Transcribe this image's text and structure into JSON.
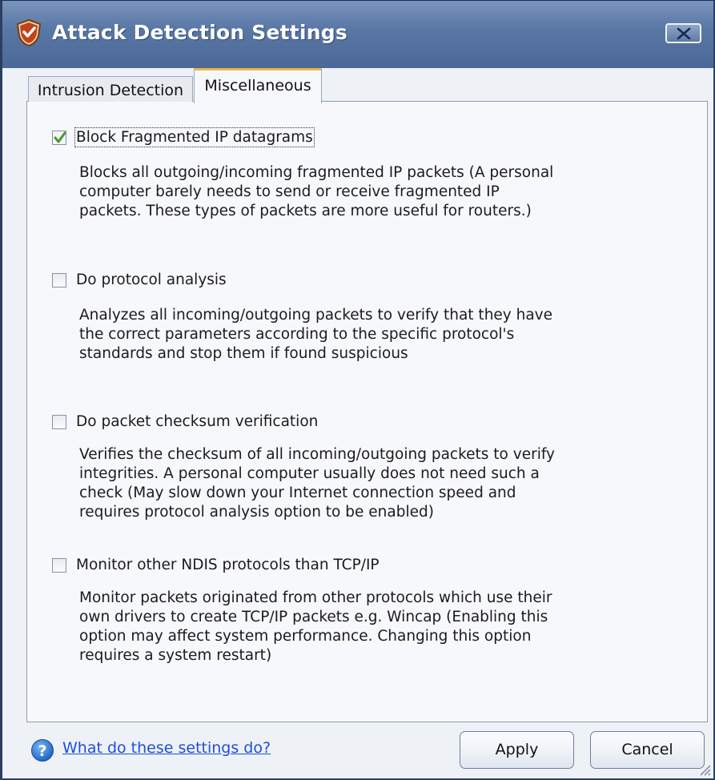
{
  "window": {
    "title": "Attack Detection Settings",
    "close_icon": "close-x-icon",
    "app_icon": "shield-icon"
  },
  "tabs": [
    {
      "label": "Intrusion Detection",
      "selected": false
    },
    {
      "label": "Miscellaneous",
      "selected": true
    }
  ],
  "options": [
    {
      "label": "Block Fragmented IP datagrams",
      "checked": true,
      "description": [
        "Blocks all outgoing/incoming fragmented IP packets (A personal",
        "computer barely needs to send or receive fragmented IP",
        "packets. These types of packets are more useful for routers.)"
      ]
    },
    {
      "label": "Do protocol analysis",
      "checked": false,
      "description": [
        "Analyzes all incoming/outgoing packets to verify that they have",
        "the correct parameters according to the specific protocol's",
        "standards and stop them if found suspicious"
      ]
    },
    {
      "label": "Do packet checksum verification",
      "checked": false,
      "description": [
        "Verifies the checksum of all incoming/outgoing packets to verify",
        "integrities. A personal computer usually does not need such a",
        "check (May slow down your Internet connection speed and",
        "requires protocol analysis option to be enabled)"
      ]
    },
    {
      "label": "Monitor other NDIS protocols than TCP/IP",
      "checked": false,
      "description": [
        "Monitor packets originated from other protocols which use their",
        "own drivers to create TCP/IP packets e.g. Wincap (Enabling this",
        "option may affect system performance. Changing this option",
        "requires a system restart)"
      ]
    }
  ],
  "footer": {
    "help_link": "What do these settings do?",
    "help_icon": "question-mark-icon",
    "apply_label": "Apply",
    "cancel_label": "Cancel"
  },
  "colors": {
    "title_bar": "#5a78a6",
    "link": "#1f4fd8",
    "selected_tab_accent": "#e9b843",
    "check_mark": "#4a9a2a"
  }
}
